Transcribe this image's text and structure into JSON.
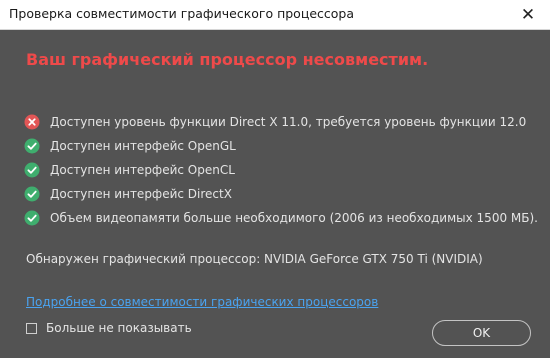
{
  "window": {
    "title": "Проверка совместимости графического процессора",
    "close_glyph": "✕"
  },
  "headline": "Ваш графический процессор несовместим.",
  "checks": [
    {
      "status": "error",
      "icon": "error-x-icon",
      "text": "Доступен уровень функции Direct X 11.0, требуется уровень функции 12.0"
    },
    {
      "status": "ok",
      "icon": "success-check-icon",
      "text": "Доступен интерфейс OpenGL"
    },
    {
      "status": "ok",
      "icon": "success-check-icon",
      "text": "Доступен интерфейс OpenCL"
    },
    {
      "status": "ok",
      "icon": "success-check-icon",
      "text": "Доступен интерфейс DirectX"
    },
    {
      "status": "ok",
      "icon": "success-check-icon",
      "text": "Объем видеопамяти больше необходимого (2006 из необходимых 1500 МБ)."
    }
  ],
  "detected_gpu": "Обнаружен графический процессор: NVIDIA GeForce GTX 750 Ti (NVIDIA)",
  "more_link": "Подробнее о совместимости графических процессоров",
  "dont_show": {
    "label": "Больше не показывать",
    "checked": false
  },
  "ok_button": "OK",
  "colors": {
    "background": "#535353",
    "headline": "#ee4a4a",
    "error": "#e25656",
    "success": "#3fae6e",
    "link": "#4aa3f0"
  }
}
